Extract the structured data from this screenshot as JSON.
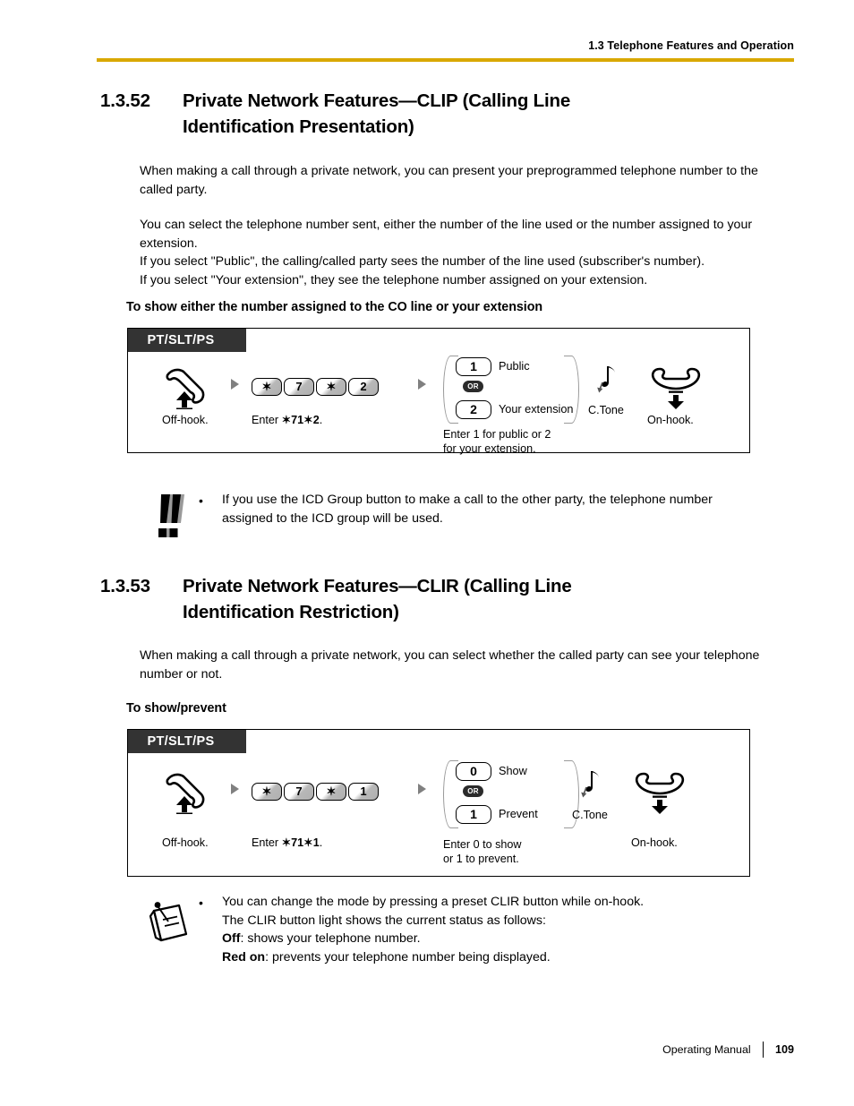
{
  "header": {
    "running_head": "1.3 Telephone Features and Operation",
    "rule_color": "#d9a800"
  },
  "sections": [
    {
      "number": "1.3.52",
      "title_line1": "Private Network Features—CLIP (Calling Line",
      "title_line2": "Identification Presentation)",
      "paragraphs": [
        "When making a call through a private network, you can present your preprogrammed telephone number to the called party.",
        "You can select the telephone number sent, either the number of the line used or the number assigned to your extension.",
        "If you select \"Public\", the calling/called party sees the number of the line used (subscriber's number).",
        "If you select \"Your extension\", they see the telephone number assigned on your extension."
      ],
      "subhead": "To show either the number assigned to the CO line or your extension",
      "diagram": {
        "device_tab": "PT/SLT/PS",
        "steps": {
          "offhook_caption": "Off-hook.",
          "enter_caption_prefix": "Enter ",
          "enter_caption_code": "✶71✶2",
          "enter_caption_suffix": ".",
          "keys": [
            "✶",
            "7",
            "✶",
            "2"
          ],
          "choice_top_key": "1",
          "choice_top_label": "Public",
          "choice_or": "OR",
          "choice_bottom_key": "2",
          "choice_bottom_label": "Your extension",
          "choice_caption_line1": "Enter 1 for public or 2",
          "choice_caption_line2": "for your extension.",
          "tone_label": "C.Tone",
          "onhook_caption": "On-hook."
        }
      },
      "note": {
        "icon": "double-exclamation-icon",
        "bullet": "•",
        "lines": [
          "If you use the ICD Group button to make a call to the other party, the telephone number",
          "assigned to the ICD group will be used."
        ]
      }
    },
    {
      "number": "1.3.53",
      "title_line1": "Private Network Features—CLIR (Calling Line",
      "title_line2": "Identification Restriction)",
      "paragraphs": [
        "When making a call through a private network, you can select whether the called party can see your telephone number or not."
      ],
      "subhead": "To show/prevent",
      "diagram": {
        "device_tab": "PT/SLT/PS",
        "steps": {
          "offhook_caption": "Off-hook.",
          "enter_caption_prefix": "Enter ",
          "enter_caption_code": "✶71✶1",
          "enter_caption_suffix": ".",
          "keys": [
            "✶",
            "7",
            "✶",
            "1"
          ],
          "choice_top_key": "0",
          "choice_top_label": "Show",
          "choice_or": "OR",
          "choice_bottom_key": "1",
          "choice_bottom_label": "Prevent",
          "choice_caption_line1": "Enter 0 to show",
          "choice_caption_line2": "or 1 to prevent.",
          "tone_label": "C.Tone",
          "onhook_caption": "On-hook."
        }
      },
      "note": {
        "icon": "memo-note-icon",
        "bullet": "•",
        "lines": [
          "You can change the mode by pressing a preset CLIR button while on-hook.",
          "The CLIR button light shows the current status as follows:",
          "Off: shows your telephone number.",
          "Red on: prevents your telephone number being displayed."
        ],
        "bold_terms": [
          "Off",
          "Red on"
        ]
      }
    }
  ],
  "footer": {
    "manual_label": "Operating Manual",
    "page_number": "109"
  }
}
